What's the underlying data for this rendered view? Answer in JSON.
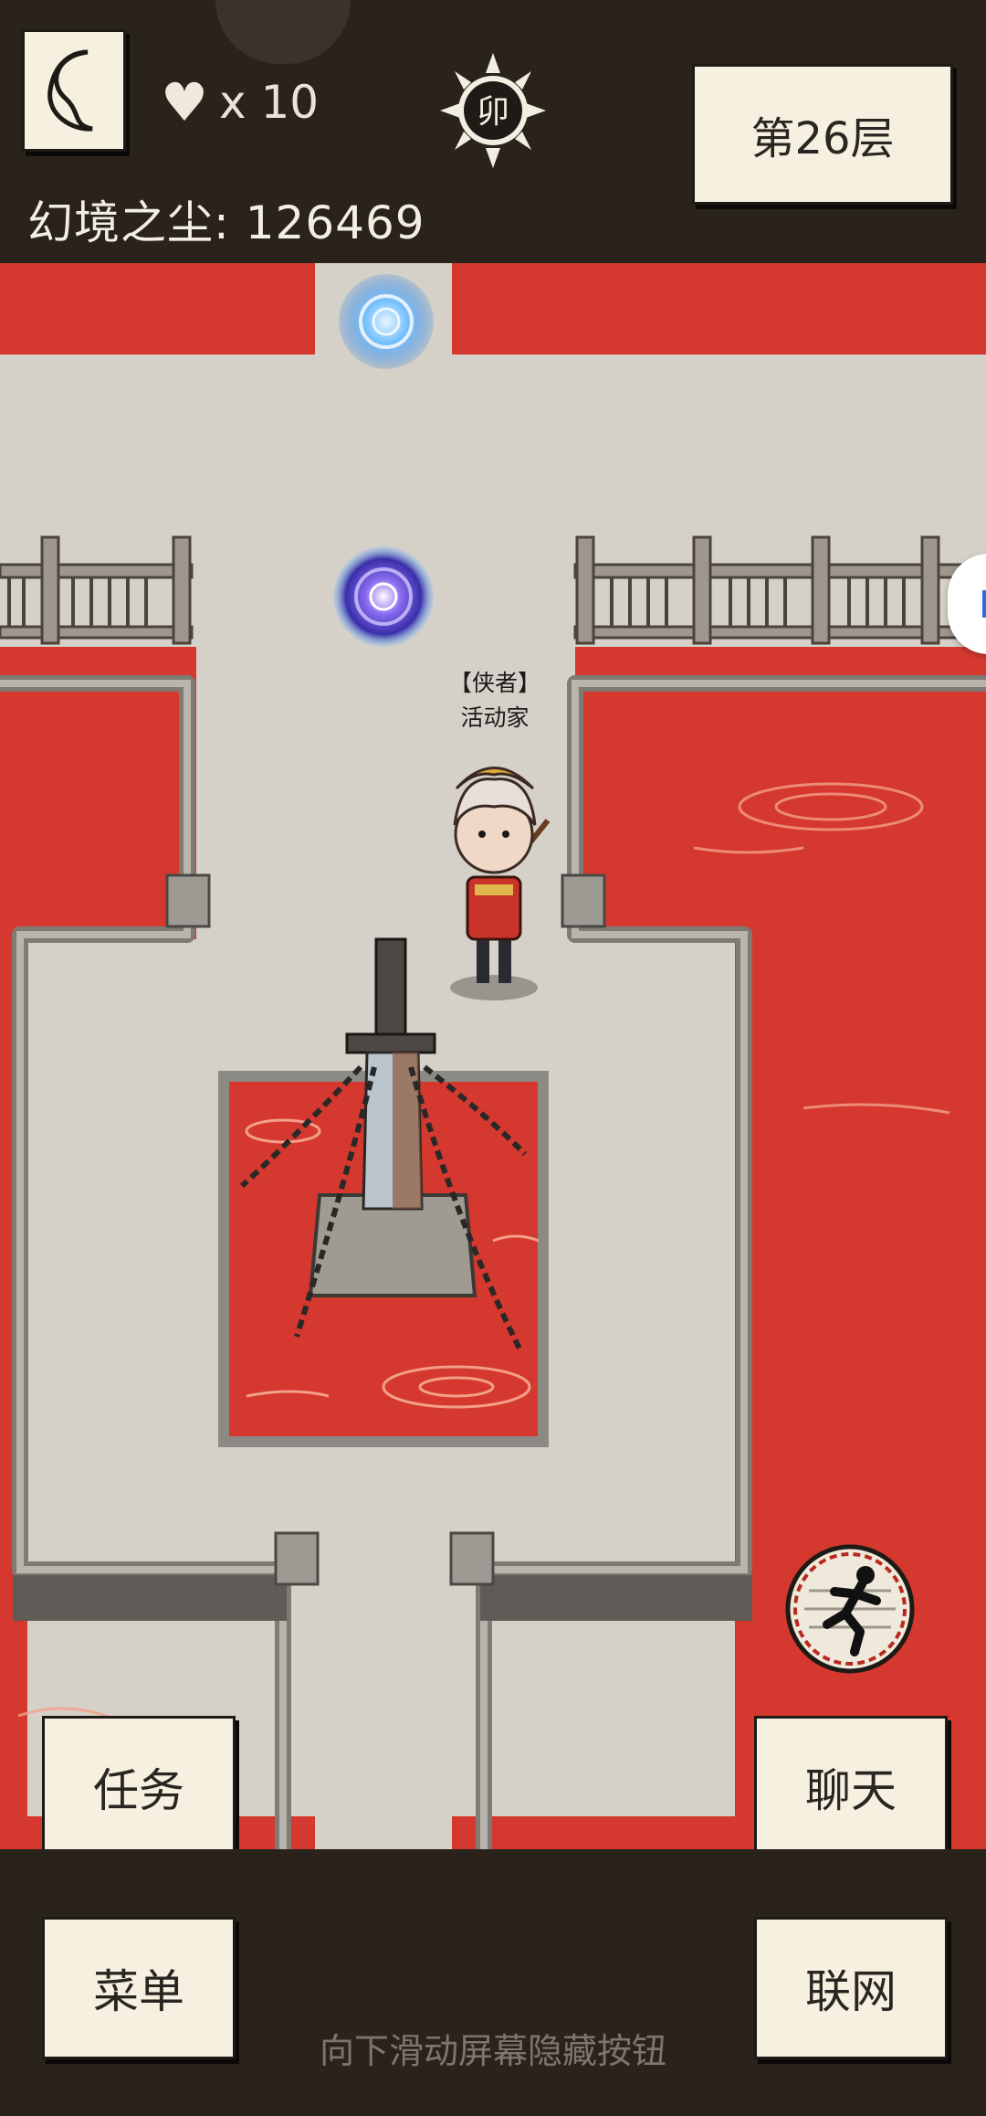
{
  "hud": {
    "lives_symbol": "♥",
    "lives_label": "x 10",
    "zodiac_badge": "卯",
    "floor_label": "第26层",
    "currency_label": "幻境之尘: 126469"
  },
  "player": {
    "title": "【侠者】",
    "name": "活动家"
  },
  "buttons": {
    "task": "任务",
    "chat": "聊天",
    "menu": "菜单",
    "network": "联网"
  },
  "hint": "向下滑动屏幕隐藏按钮",
  "colors": {
    "lava": "#d4382e",
    "stone": "#d6d1c8",
    "wall": "#8c8a84",
    "dark": "#2a231b",
    "paper": "#f6f0e1",
    "portal_blue": "#4aa6ff",
    "portal_purple": "#6b4fd8"
  },
  "icons": [
    "back-crescent-icon",
    "heart-icon",
    "sun-badge-icon",
    "run-icon",
    "portal-icon",
    "sword-icon"
  ]
}
